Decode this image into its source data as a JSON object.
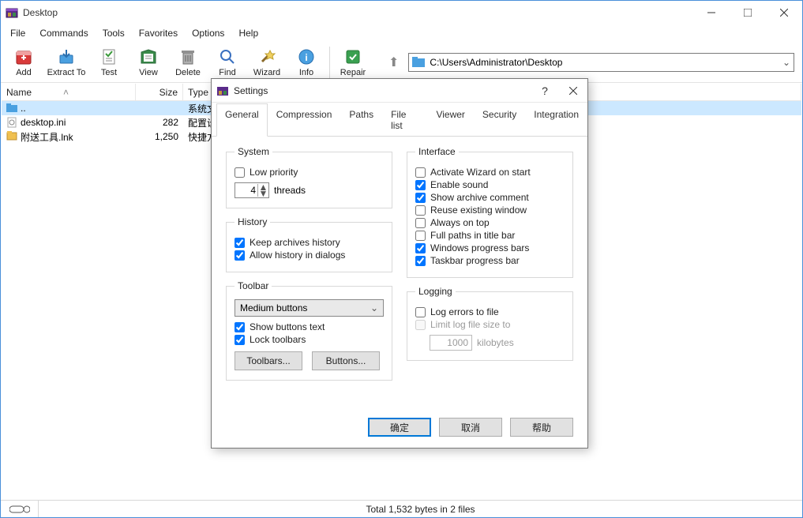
{
  "window": {
    "title": "Desktop"
  },
  "menu": {
    "items": [
      "File",
      "Commands",
      "Tools",
      "Favorites",
      "Options",
      "Help"
    ]
  },
  "toolbar": {
    "buttons": [
      {
        "label": "Add"
      },
      {
        "label": "Extract To"
      },
      {
        "label": "Test"
      },
      {
        "label": "View"
      },
      {
        "label": "Delete"
      },
      {
        "label": "Find"
      },
      {
        "label": "Wizard"
      },
      {
        "label": "Info"
      }
    ],
    "repair": "Repair",
    "path": "C:\\Users\\Administrator\\Desktop"
  },
  "columns": {
    "name": "Name",
    "size": "Size",
    "type": "Type"
  },
  "files": [
    {
      "name": "..",
      "size": "",
      "type": "系统文件夹",
      "kind": "up"
    },
    {
      "name": "desktop.ini",
      "size": "282",
      "type": "配置设置",
      "kind": "ini"
    },
    {
      "name": "附送工具.lnk",
      "size": "1,250",
      "type": "快捷方式",
      "kind": "lnk"
    }
  ],
  "status": {
    "text": "Total 1,532 bytes in 2 files"
  },
  "dialog": {
    "title": "Settings",
    "tabs": [
      "General",
      "Compression",
      "Paths",
      "File list",
      "Viewer",
      "Security",
      "Integration"
    ],
    "active_tab": "General",
    "system": {
      "legend": "System",
      "low_priority": "Low priority",
      "threads_value": "4",
      "threads_label": "threads"
    },
    "history": {
      "legend": "History",
      "keep": "Keep archives history",
      "allow": "Allow history in dialogs"
    },
    "toolbar_grp": {
      "legend": "Toolbar",
      "combo": "Medium buttons",
      "show_text": "Show buttons text",
      "lock": "Lock toolbars",
      "btn_toolbars": "Toolbars...",
      "btn_buttons": "Buttons..."
    },
    "interface": {
      "legend": "Interface",
      "wizard": "Activate Wizard on start",
      "sound": "Enable sound",
      "comment": "Show archive comment",
      "reuse": "Reuse existing window",
      "ontop": "Always on top",
      "fullpaths": "Full paths in title bar",
      "winprog": "Windows progress bars",
      "taskprog": "Taskbar progress bar"
    },
    "logging": {
      "legend": "Logging",
      "logfile": "Log errors to file",
      "limit": "Limit log file size to",
      "size_value": "1000",
      "size_unit": "kilobytes"
    },
    "buttons": {
      "ok": "确定",
      "cancel": "取消",
      "help": "帮助"
    }
  }
}
